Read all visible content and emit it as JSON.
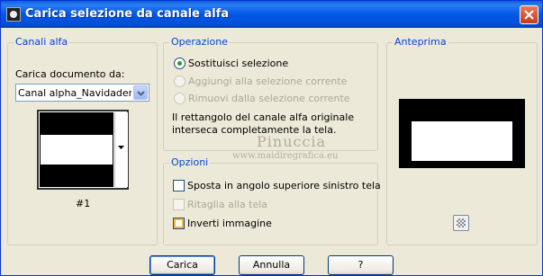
{
  "window": {
    "title": "Carica selezione da canale alfa"
  },
  "icons": {
    "app": "app-icon",
    "close": "close-icon",
    "dropdown": "chevron-down-icon",
    "zoom": "checkerboard-icon"
  },
  "alpha_channels": {
    "group_label": "Canali alfa",
    "load_document_label": "Carica documento da:",
    "document_select_value": "Canal alpha_NavidadenTi",
    "channel_label": "#1"
  },
  "operation": {
    "group_label": "Operazione",
    "options": [
      {
        "label": "Sostituisci selezione",
        "checked": true,
        "enabled": true
      },
      {
        "label": "Aggiungi alla selezione corrente",
        "checked": false,
        "enabled": false
      },
      {
        "label": "Rimuovi dalla selezione corrente",
        "checked": false,
        "enabled": false
      }
    ],
    "info_line1": "Il rettangolo del canale alfa originale",
    "info_line2": "interseca completamente la tela."
  },
  "watermark": {
    "name": "Pinuccia",
    "url": "www.maidiregrafica.eu"
  },
  "options": {
    "group_label": "Opzioni",
    "items": [
      {
        "label": "Sposta in angolo superiore sinistro tela",
        "checked": false,
        "enabled": true
      },
      {
        "label": "Ritaglia alla tela",
        "checked": false,
        "enabled": false
      },
      {
        "label": "Inverti immagine",
        "checked": false,
        "enabled": true
      }
    ]
  },
  "preview": {
    "group_label": "Anteprima"
  },
  "buttons": {
    "ok": "Carica",
    "cancel": "Annulla",
    "help": "?"
  },
  "colors": {
    "titlebar": "#0058e6",
    "group_label": "#0046d5",
    "dialog_bg": "#ece9d8",
    "radio_dot": "#21a121",
    "close_button": "#c23b17"
  }
}
